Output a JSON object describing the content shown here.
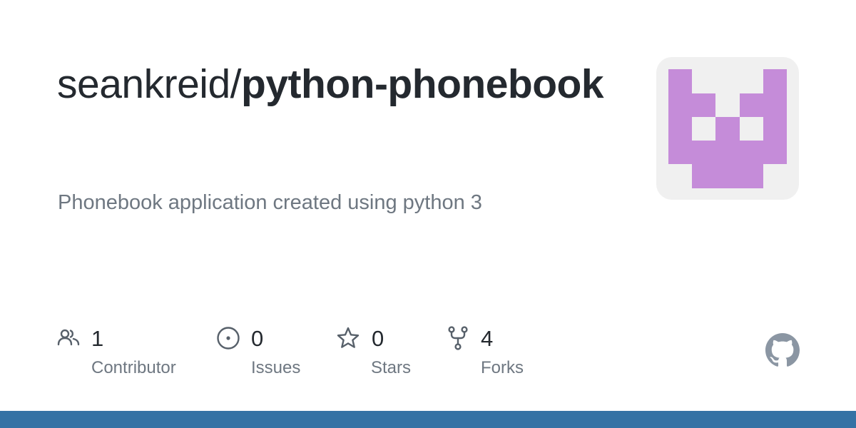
{
  "repo": {
    "owner": "seankreid/",
    "name": "python-phonebook",
    "description": "Phonebook application created using python 3"
  },
  "avatar": {
    "background": "#f0f0f0",
    "pattern_color": "#c58cd9"
  },
  "stats": [
    {
      "icon": "people-icon",
      "count": "1",
      "label": "Contributor"
    },
    {
      "icon": "issue-icon",
      "count": "0",
      "label": "Issues"
    },
    {
      "icon": "star-icon",
      "count": "0",
      "label": "Stars"
    },
    {
      "icon": "fork-icon",
      "count": "4",
      "label": "Forks"
    }
  ],
  "colors": {
    "text": "#24292f",
    "muted": "#6e7781",
    "icon": "#57606a",
    "github_mark": "#8b96a3",
    "bottom_bar": "#3572a5"
  }
}
